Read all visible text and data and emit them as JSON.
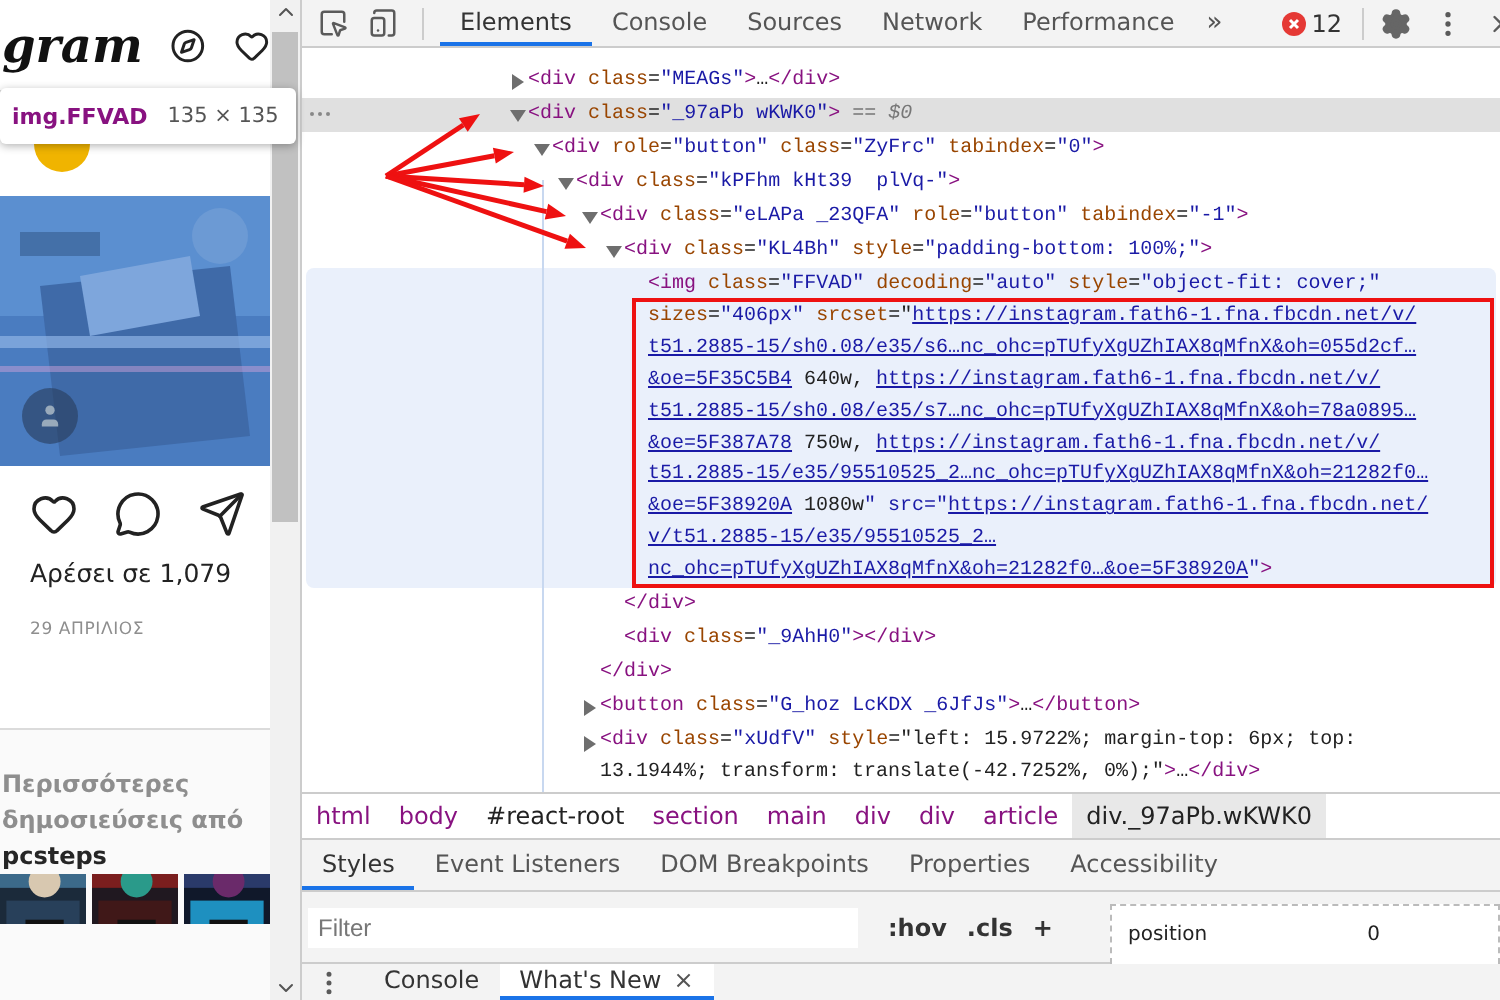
{
  "page": {
    "logo": "gram",
    "tooltip": {
      "selector": "img.FFVAD",
      "size": "135 × 135"
    },
    "likes": "Αρέσει σε 1,079",
    "date": "29 ΑΠΡΙΛΙΟΣ",
    "more_posts": {
      "lines": [
        "Περισσότερες",
        "δημοσιεύσεις από"
      ],
      "account": "pcsteps"
    }
  },
  "devtools": {
    "tabs": [
      {
        "label": "Elements",
        "selected": true
      },
      {
        "label": "Console",
        "selected": false
      },
      {
        "label": "Sources",
        "selected": false
      },
      {
        "label": "Network",
        "selected": false
      },
      {
        "label": "Performance",
        "selected": false
      }
    ],
    "more_tabs": "»",
    "error_count": "12",
    "tree": [
      {
        "text": "<div class=\"MEAGs\">…</div>",
        "expanded": false,
        "selected": false,
        "highlighted": false
      },
      {
        "text": "<div class=\"_97aPb wKWK0\">",
        "marker": "== $0",
        "expanded": true,
        "selected": true,
        "highlighted": false,
        "children": [
          {
            "text": "<div role=\"button\" class=\"ZyFrc\" tabindex=\"0\">",
            "expanded": true,
            "selected": false,
            "highlighted": false,
            "children": [
              {
                "text": "<div class=\"kPFhm kHt39  plVq-\">",
                "expanded": true,
                "selected": false,
                "highlighted": false,
                "children": [
                  {
                    "text": "<div class=\"eLAPa _23QFA\" role=\"button\" tabindex=\"-1\">",
                    "expanded": true,
                    "selected": false,
                    "highlighted": false,
                    "children": [
                      {
                        "text": "<div class=\"KL4Bh\" style=\"padding-bottom: 100%;\">",
                        "expanded": true,
                        "selected": false,
                        "highlighted": false,
                        "close": "</div>",
                        "children": [
                          {
                            "selected": false,
                            "highlighted": true,
                            "lines": [
                              [
                                {
                                  "kind": "code",
                                  "text": "<img class=\"FFVAD\" decoding=\"auto\" style=\"object-fit: cover;\""
                                }
                              ],
                              [
                                {
                                  "kind": "code",
                                  "text": "sizes=\"406px\" srcset=\""
                                },
                                {
                                  "kind": "link",
                                  "text": "https://instagram.fath6-1.fna.fbcdn.net/v/"
                                }
                              ],
                              [
                                {
                                  "kind": "link",
                                  "text": "t51.2885-15/sh0.08/e35/s6…nc_ohc=pTUfyXgUZhIAX8qMfnX&oh=055d2cf…"
                                }
                              ],
                              [
                                {
                                  "kind": "link",
                                  "text": "&oe=5F35C5B4"
                                },
                                {
                                  "kind": "code",
                                  "text": " 640w, "
                                },
                                {
                                  "kind": "link",
                                  "text": "https://instagram.fath6-1.fna.fbcdn.net/v/"
                                }
                              ],
                              [
                                {
                                  "kind": "link",
                                  "text": "t51.2885-15/sh0.08/e35/s7…nc_ohc=pTUfyXgUZhIAX8qMfnX&oh=78a0895…"
                                }
                              ],
                              [
                                {
                                  "kind": "link",
                                  "text": "&oe=5F387A78"
                                },
                                {
                                  "kind": "code",
                                  "text": " 750w, "
                                },
                                {
                                  "kind": "link",
                                  "text": "https://instagram.fath6-1.fna.fbcdn.net/v/"
                                }
                              ],
                              [
                                {
                                  "kind": "link",
                                  "text": "t51.2885-15/e35/95510525_2…nc_ohc=pTUfyXgUZhIAX8qMfnX&oh=21282f0…"
                                }
                              ],
                              [
                                {
                                  "kind": "link",
                                  "text": "&oe=5F38920A"
                                },
                                {
                                  "kind": "code",
                                  "text": " 1080w\" src=\""
                                },
                                {
                                  "kind": "link",
                                  "text": "https://instagram.fath6-1.fna.fbcdn.net/"
                                }
                              ],
                              [
                                {
                                  "kind": "link",
                                  "text": "v/t51.2885-15/e35/95510525_2…"
                                }
                              ],
                              [
                                {
                                  "kind": "link",
                                  "text": "nc_ohc=pTUfyXgUZhIAX8qMfnX&oh=21282f0…&oe=5F38920A"
                                },
                                {
                                  "kind": "code",
                                  "text": "\">"
                                }
                              ]
                            ]
                          }
                        ]
                      },
                      {
                        "text": "<div class=\"_9AhH0\"></div>",
                        "selected": false,
                        "highlighted": false
                      }
                    ],
                    "close": "</div>"
                  },
                  {
                    "text": "<button class=\"G_hoz LcKDX _6JfJs\">…</button>",
                    "expanded": false,
                    "selected": false,
                    "highlighted": false
                  },
                  {
                    "expanded": false,
                    "selected": false,
                    "highlighted": false,
                    "lines": [
                      [
                        {
                          "kind": "code",
                          "text": "<div class=\"xUdfV\" style=\"left: 15.9722%; margin-top: 6px; top:"
                        }
                      ],
                      [
                        {
                          "kind": "code",
                          "text": "13.1944%; transform: translate(-42.7252%, 0%);\">…</div>"
                        }
                      ]
                    ]
                  }
                ]
              }
            ]
          }
        ]
      }
    ],
    "breadcrumbs": [
      {
        "label": "html",
        "kind": "tag",
        "selected": false
      },
      {
        "label": "body",
        "kind": "tag",
        "selected": false
      },
      {
        "label": "#react-root",
        "kind": "id",
        "selected": false
      },
      {
        "label": "section",
        "kind": "tag",
        "selected": false
      },
      {
        "label": "main",
        "kind": "tag",
        "selected": false
      },
      {
        "label": "div",
        "kind": "tag",
        "selected": false
      },
      {
        "label": "div",
        "kind": "tag",
        "selected": false
      },
      {
        "label": "article",
        "kind": "tag",
        "selected": false
      },
      {
        "label": "div._97aPb.wKWK0",
        "kind": "tag",
        "selected": true
      }
    ],
    "styles_tabs": [
      {
        "label": "Styles",
        "selected": true
      },
      {
        "label": "Event Listeners",
        "selected": false
      },
      {
        "label": "DOM Breakpoints",
        "selected": false
      },
      {
        "label": "Properties",
        "selected": false
      },
      {
        "label": "Accessibility",
        "selected": false
      }
    ],
    "filter": {
      "placeholder": "Filter"
    },
    "filter_buttons": [
      ":hov",
      ".cls",
      "+"
    ],
    "box_model": {
      "label": "position",
      "value": "0"
    },
    "drawer_tabs": [
      {
        "label": "Console",
        "selected": false
      },
      {
        "label": "What's New",
        "selected": true,
        "close": "×"
      }
    ]
  }
}
